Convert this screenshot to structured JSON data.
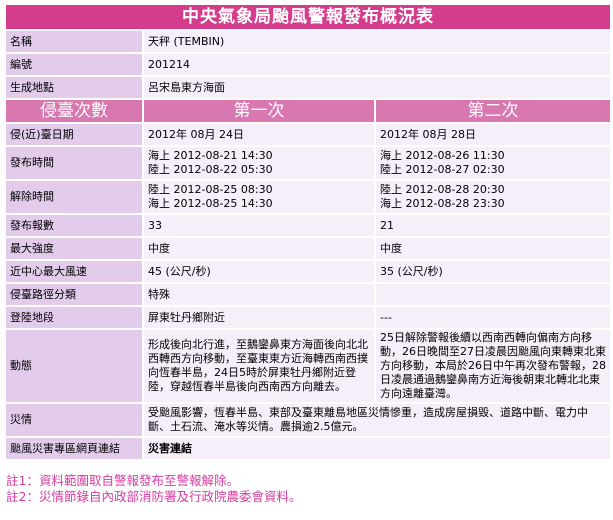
{
  "title": "中央氣象局颱風警報發布概況表",
  "rows": {
    "name": {
      "label": "名稱",
      "value": "天秤 (TEMBIN)"
    },
    "number": {
      "label": "編號",
      "value": "201214"
    },
    "origin": {
      "label": "生成地點",
      "value": "呂宋島東方海面"
    }
  },
  "header": {
    "col0": "侵臺次數",
    "col1": "第一次",
    "col2": "第二次"
  },
  "multi": {
    "date": {
      "label": "侵(近)臺日期",
      "v1": "2012年 08月 24日",
      "v2": "2012年 08月 28日"
    },
    "issue": {
      "label": "發布時間",
      "v1": [
        "海上 2012-08-21 14:30",
        "陸上 2012-08-22 05:30"
      ],
      "v2": [
        "海上 2012-08-26 11:30",
        "陸上 2012-08-27 02:30"
      ]
    },
    "lift": {
      "label": "解除時間",
      "v1": [
        "陸上 2012-08-25 08:30",
        "海上 2012-08-25 14:30"
      ],
      "v2": [
        "陸上 2012-08-28 20:30",
        "海上 2012-08-28 23:30"
      ]
    },
    "reports": {
      "label": "發布報數",
      "v1": "33",
      "v2": "21"
    },
    "intensity": {
      "label": "最大強度",
      "v1": "中度",
      "v2": "中度"
    },
    "wind": {
      "label": "近中心最大風速",
      "v1": "45 (公尺/秒)",
      "v2": "35 (公尺/秒)"
    },
    "path": {
      "label": "侵臺路徑分類",
      "v1": "特殊",
      "v2": ""
    },
    "landfall": {
      "label": "登陸地段",
      "v1": "屏東牡丹鄉附近",
      "v2": "---"
    },
    "movement": {
      "label": "動態",
      "v1": "形成後向北行進，至鵝鑾鼻東方海面後向北北西轉西方向移動，至臺東東方近海轉西南西撲向恆春半島，24日5時於屏東牡丹鄉附近登陸，穿越恆春半島後向西南西方向離去。",
      "v2": "25日解除警報後續以西南西轉向偏南方向移動，26日晚間至27日凌晨因颱風向東轉東北東方向移動，本局於26日中午再次發布警報，28日凌晨通過鵝鑾鼻南方近海後朝東北轉北北東方向遠離臺灣。"
    },
    "disaster": {
      "label": "災情",
      "value": "受颱風影響，恆春半島、東部及臺東離島地區災情慘重，造成房屋損毀、道路中斷、電力中斷、土石流、淹水等災情。農損逾2.5億元。"
    },
    "link": {
      "label": "颱風災害專區網頁連結",
      "value": "災害連結"
    }
  },
  "notes": [
    "註1：資料範圍取自警報發布至警報解除。",
    "註2：災情節錄自內政部消防署及行政院農委會資料。"
  ]
}
